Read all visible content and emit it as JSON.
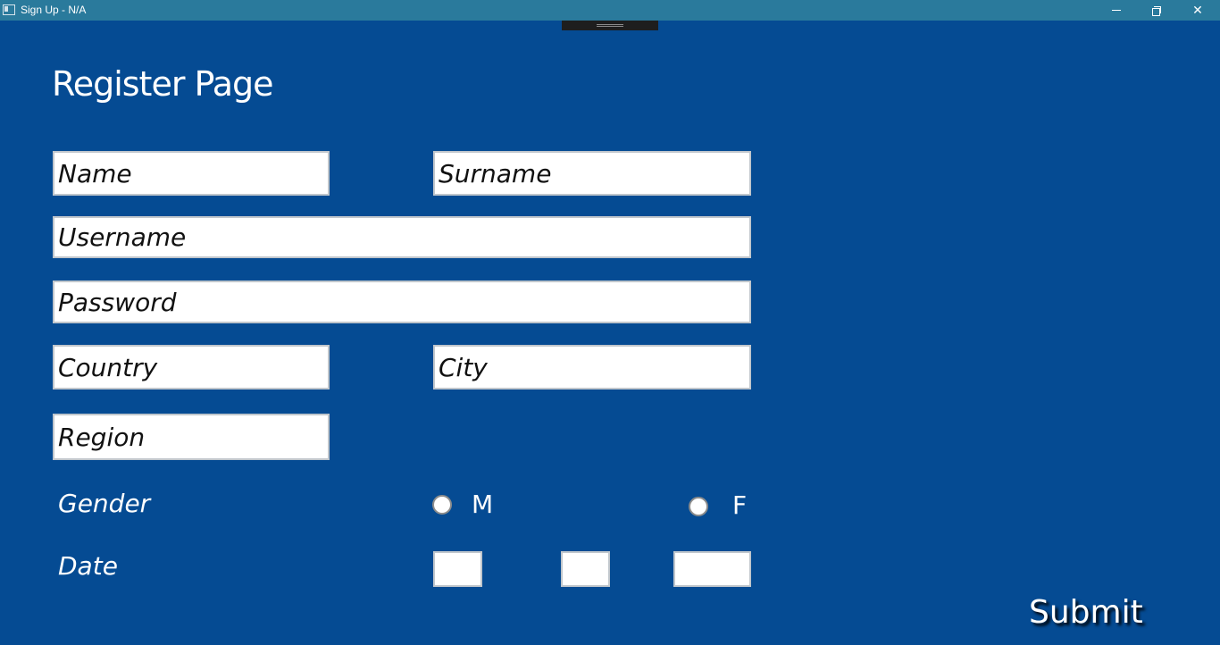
{
  "window": {
    "title": "Sign Up - N/A",
    "icon": "app-window-icon",
    "controls": [
      "minimize-icon",
      "restore-icon",
      "close-icon"
    ]
  },
  "page": {
    "title": "Register Page",
    "background_color": "#054b93"
  },
  "form": {
    "name_placeholder": "Name",
    "surname_placeholder": "Surname",
    "username_placeholder": "Username",
    "password_placeholder": "Password",
    "country_placeholder": "Country",
    "city_placeholder": "City",
    "region_placeholder": "Region",
    "gender_label": "Gender",
    "gender_options": {
      "male": "M",
      "female": "F"
    },
    "date_label": "Date",
    "date_day": "",
    "date_month": "",
    "date_year": "",
    "submit_label": "Submit"
  }
}
